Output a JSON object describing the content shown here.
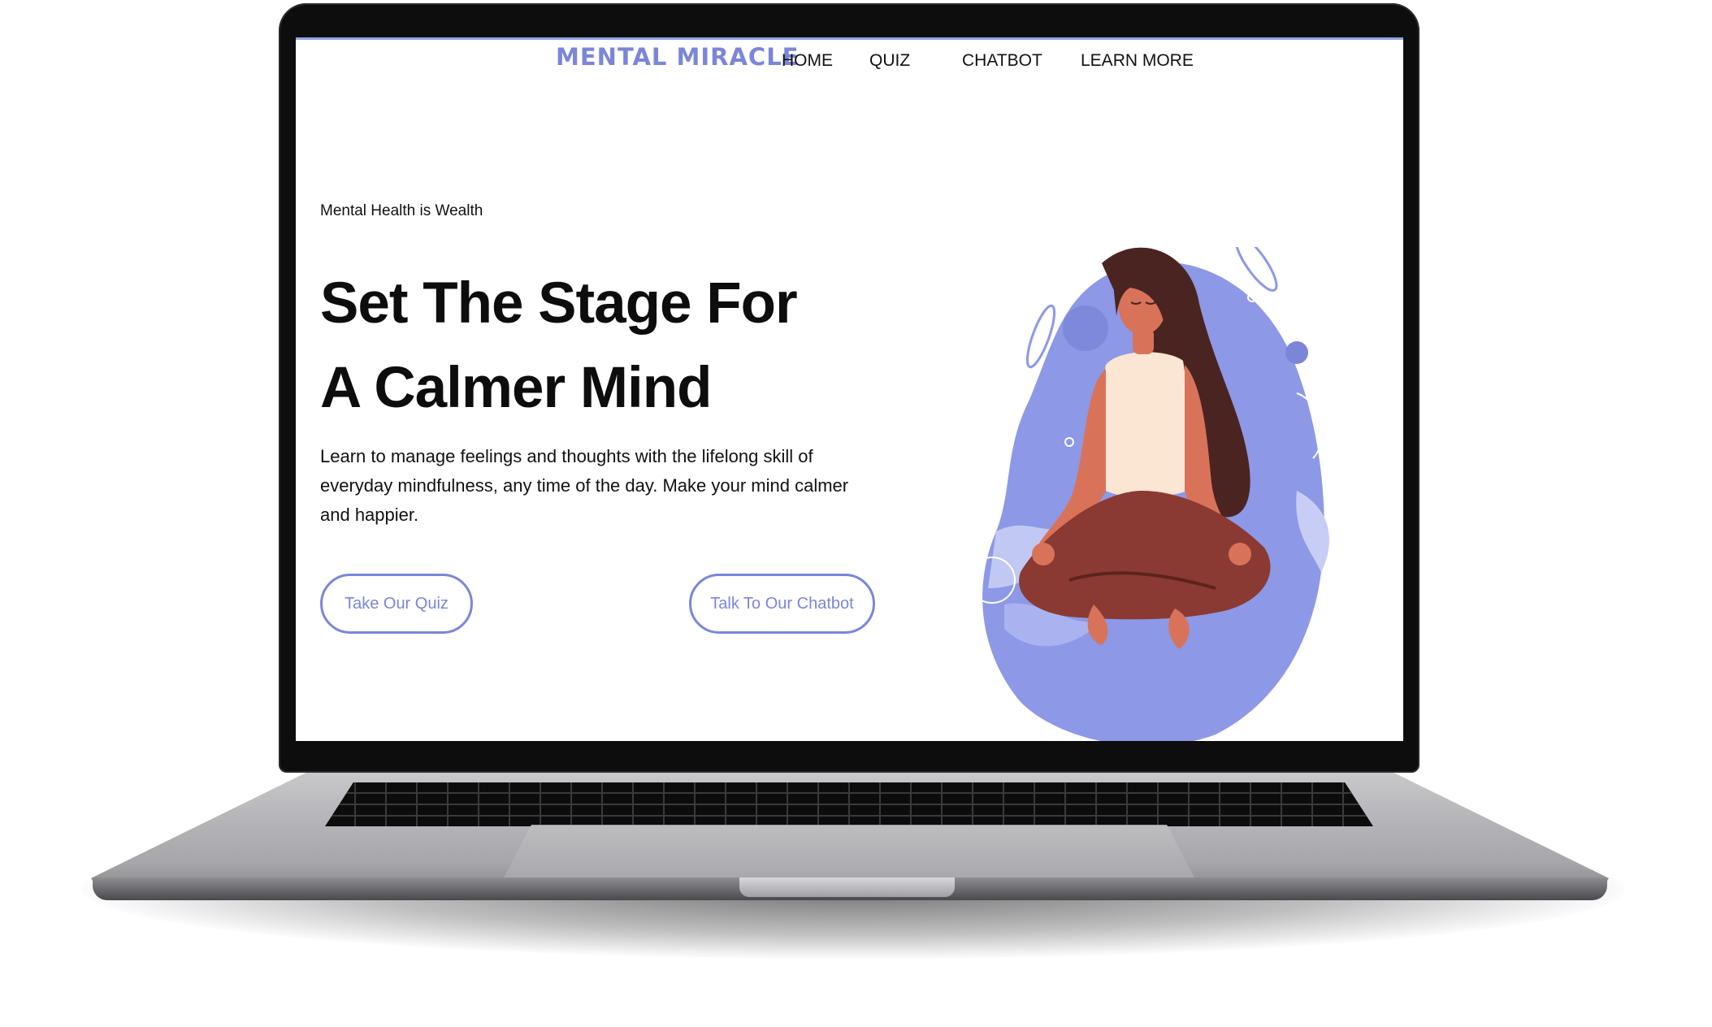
{
  "site": {
    "brand": "MENTAL MIRACLE",
    "nav": [
      {
        "label": "HOME"
      },
      {
        "label": "QUIZ"
      },
      {
        "label": "CHATBOT"
      },
      {
        "label": "LEARN MORE"
      }
    ]
  },
  "hero": {
    "tagline": "Mental Health is Wealth",
    "headline_line1": "Set The Stage For",
    "headline_line2": "A Calmer Mind",
    "description": "Learn to manage feelings and thoughts with the lifelong skill of everyday mindfulness, any time of the day. Make your mind calmer and happier.",
    "buttons": {
      "quiz": "Take Our Quiz",
      "chatbot": "Talk To Our Chatbot"
    },
    "illustration": "meditating-woman-illustration"
  },
  "colors": {
    "accent": "#7b86d8",
    "accent_light": "#a9b2ee",
    "text": "#111111",
    "skin": "#d8735a",
    "hair": "#4a2421",
    "top": "#fbe5d3",
    "pants": "#8a3a33"
  }
}
